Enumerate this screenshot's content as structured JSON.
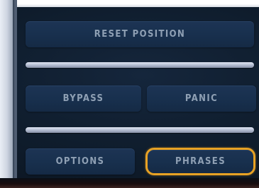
{
  "controls": {
    "reset_position_label": "RESET POSITION",
    "bypass_label": "BYPASS",
    "panic_label": "PANIC",
    "options_label": "OPTIONS",
    "phrases_label": "PHRASES"
  },
  "colors": {
    "button_fill": "#18304e",
    "button_text": "#8fa0b4",
    "slider": "#b9c2d6",
    "highlight": "#e8a224"
  }
}
